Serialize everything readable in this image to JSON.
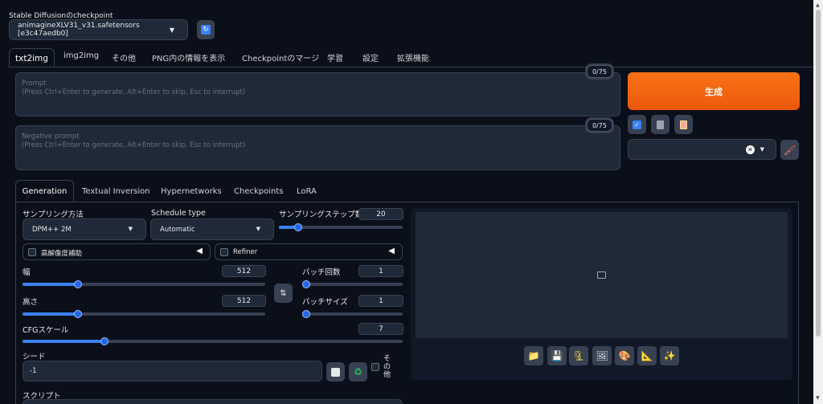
{
  "checkpoint": {
    "label": "Stable Diffusionのcheckpoint",
    "value": "animagineXLV31_v31.safetensors [e3c47aedb0]"
  },
  "tabs": [
    "txt2img",
    "img2img",
    "その他",
    "PNG内の情報を表示",
    "Checkpointのマージ",
    "学習",
    "設定",
    "拡張機能"
  ],
  "prompt": {
    "title": "Prompt",
    "hint": "(Press Ctrl+Enter to generate, Alt+Enter to skip, Esc to interrupt)",
    "counter": "0/75"
  },
  "negative_prompt": {
    "title": "Negative prompt",
    "hint": "(Press Ctrl+Enter to generate, Alt+Enter to skip, Esc to interrupt)",
    "counter": "0/75"
  },
  "generate_label": "生成",
  "subtabs": [
    "Generation",
    "Textual Inversion",
    "Hypernetworks",
    "Checkpoints",
    "LoRA"
  ],
  "sampling": {
    "method_label": "サンプリング方法",
    "method_value": "DPM++ 2M",
    "schedule_label": "Schedule type",
    "schedule_value": "Automatic",
    "steps_label": "サンプリングステップ数",
    "steps_value": "20",
    "steps_fraction": 0.13
  },
  "hires_label": "高解像度補助",
  "refiner_label": "Refiner",
  "width": {
    "label": "幅",
    "value": "512",
    "fraction": 0.22
  },
  "height": {
    "label": "高さ",
    "value": "512",
    "fraction": 0.22
  },
  "batch_count": {
    "label": "バッチ回数",
    "value": "1",
    "fraction": 0.0
  },
  "batch_size": {
    "label": "バッチサイズ",
    "value": "1",
    "fraction": 0.0
  },
  "cfg": {
    "label": "CFGスケール",
    "value": "7",
    "fraction": 0.21
  },
  "seed": {
    "label": "シード",
    "value": "-1",
    "extra_label": "その他"
  },
  "script_label": "スクリプト",
  "colors": {
    "accent": "#f97316",
    "slider": "#3b82f6",
    "bg": "#0b0f19"
  }
}
